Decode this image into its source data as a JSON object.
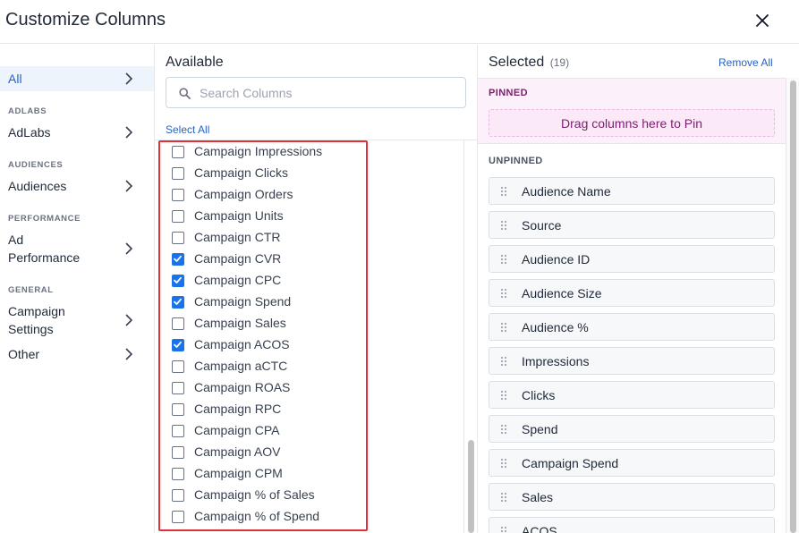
{
  "dialog": {
    "title": "Customize Columns"
  },
  "nav": {
    "all_label": "All",
    "sections": [
      {
        "header": "ADLABS",
        "item": "AdLabs"
      },
      {
        "header": "AUDIENCES",
        "item": "Audiences"
      },
      {
        "header": "PERFORMANCE",
        "item": "Ad Performance"
      },
      {
        "header": "GENERAL",
        "item": "Campaign Settings"
      }
    ],
    "other_label": "Other"
  },
  "available": {
    "title": "Available",
    "search_placeholder": "Search Columns",
    "select_all": "Select All",
    "columns": [
      {
        "label": "Campaign Impressions",
        "checked": false
      },
      {
        "label": "Campaign Clicks",
        "checked": false
      },
      {
        "label": "Campaign Orders",
        "checked": false
      },
      {
        "label": "Campaign Units",
        "checked": false
      },
      {
        "label": "Campaign CTR",
        "checked": false
      },
      {
        "label": "Campaign CVR",
        "checked": true
      },
      {
        "label": "Campaign CPC",
        "checked": true
      },
      {
        "label": "Campaign Spend",
        "checked": true
      },
      {
        "label": "Campaign Sales",
        "checked": false
      },
      {
        "label": "Campaign ACOS",
        "checked": true
      },
      {
        "label": "Campaign aCTC",
        "checked": false
      },
      {
        "label": "Campaign ROAS",
        "checked": false
      },
      {
        "label": "Campaign RPC",
        "checked": false
      },
      {
        "label": "Campaign CPA",
        "checked": false
      },
      {
        "label": "Campaign AOV",
        "checked": false
      },
      {
        "label": "Campaign CPM",
        "checked": false
      },
      {
        "label": "Campaign % of Sales",
        "checked": false
      },
      {
        "label": "Campaign % of Spend",
        "checked": false
      }
    ]
  },
  "selected": {
    "title": "Selected",
    "count": "(19)",
    "remove_all": "Remove All",
    "pinned_label": "PINNED",
    "pin_drop_text": "Drag columns here to Pin",
    "unpinned_label": "UNPINNED",
    "items": [
      "Audience Name",
      "Source",
      "Audience ID",
      "Audience Size",
      "Audience %",
      "Impressions",
      "Clicks",
      "Spend",
      "Campaign Spend",
      "Sales",
      "ACOS"
    ]
  },
  "colors": {
    "accent": "#2563c9",
    "checkbox_checked": "#1a73e8",
    "highlight": "#e0313b",
    "pinned_bg": "#fcf1fb"
  }
}
